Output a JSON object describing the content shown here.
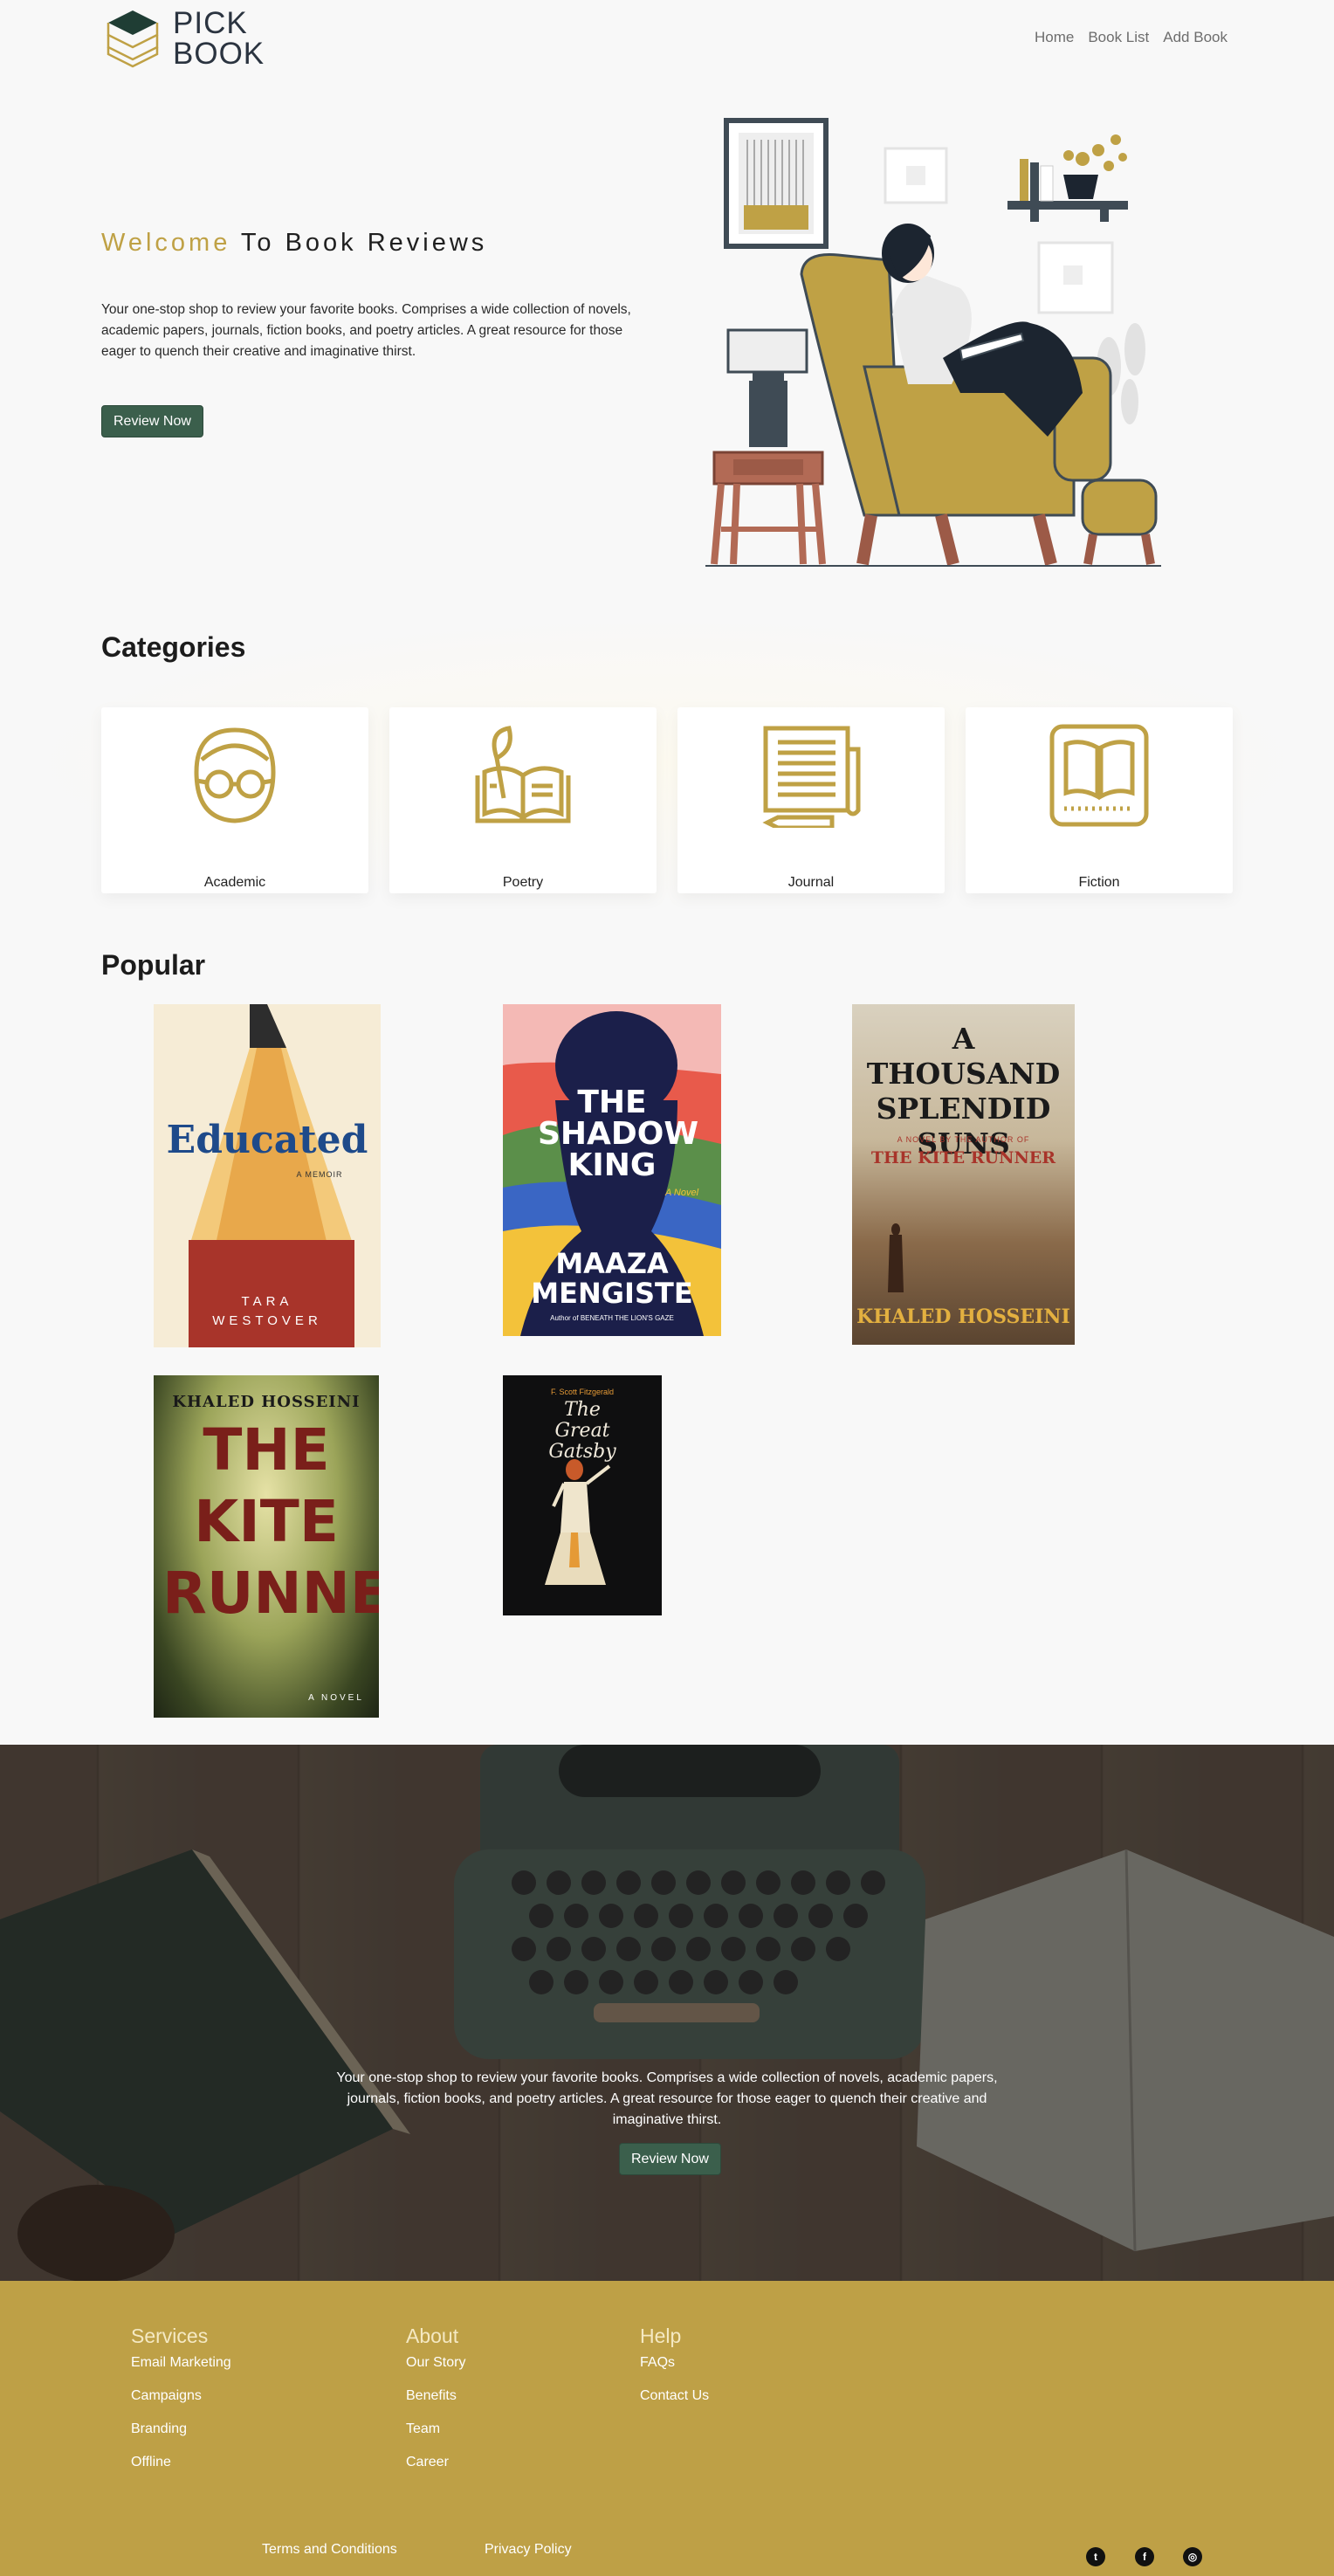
{
  "brand": {
    "line1": "PICK",
    "line2": "BOOK"
  },
  "nav": [
    {
      "label": "Home"
    },
    {
      "label": "Book List"
    },
    {
      "label": "Add Book"
    }
  ],
  "hero": {
    "title_accent": "Welcome",
    "title_rest": " To Book Reviews",
    "description": "Your one-stop shop to review your favorite books. Comprises a wide collection of novels, academic papers, journals, fiction books, and poetry articles. A great resource for those eager to quench their creative and imaginative thirst.",
    "button": "Review Now"
  },
  "categories": {
    "title": "Categories",
    "items": [
      {
        "label": "Academic",
        "icon": "glasses-face-icon"
      },
      {
        "label": "Poetry",
        "icon": "open-book-quill-icon"
      },
      {
        "label": "Journal",
        "icon": "journal-pencil-icon"
      },
      {
        "label": "Fiction",
        "icon": "book-icon"
      }
    ]
  },
  "popular": {
    "title": "Popular",
    "books": [
      {
        "title": "Educated",
        "subtitle": "A MEMOIR",
        "author": "TARA WESTOVER"
      },
      {
        "title": "THE SHADOW KING",
        "subtitle": "A Novel",
        "author": "MAAZA MENGISTE",
        "note": "Author of BENEATH THE LION'S GAZE"
      },
      {
        "title": "A THOUSAND SPLENDID SUNS",
        "subtitle": "A NOVEL BY THE AUTHOR OF",
        "note": "THE KITE RUNNER",
        "author": "KHALED HOSSEINI"
      },
      {
        "title": "THE KITE RUNNER",
        "subtitle": "A NOVEL",
        "author": "KHALED HOSSEINI"
      },
      {
        "title": "The Great Gatsby",
        "author": "F. Scott Fitzgerald"
      }
    ]
  },
  "banner": {
    "text": "Your one-stop shop to review your favorite books. Comprises a wide collection of novels, academic papers, journals, fiction books, and poetry articles. A great resource for those eager to quench their creative and imaginative thirst.",
    "button": "Review Now"
  },
  "footer": {
    "services": {
      "title": "Services",
      "links": [
        "Email Marketing",
        "Campaigns",
        "Branding",
        "Offline"
      ]
    },
    "about": {
      "title": "About",
      "links": [
        "Our Story",
        "Benefits",
        "Team",
        "Career"
      ]
    },
    "help": {
      "title": "Help",
      "links": [
        "FAQs",
        "Contact Us"
      ]
    },
    "terms": "Terms and Conditions",
    "privacy": "Privacy Policy",
    "social": [
      {
        "icon": "twitter-icon"
      },
      {
        "icon": "facebook-icon"
      },
      {
        "icon": "instagram-icon"
      }
    ]
  },
  "colors": {
    "accent": "#bfa145",
    "button": "#3b5f4c",
    "footer": "#bea046"
  }
}
